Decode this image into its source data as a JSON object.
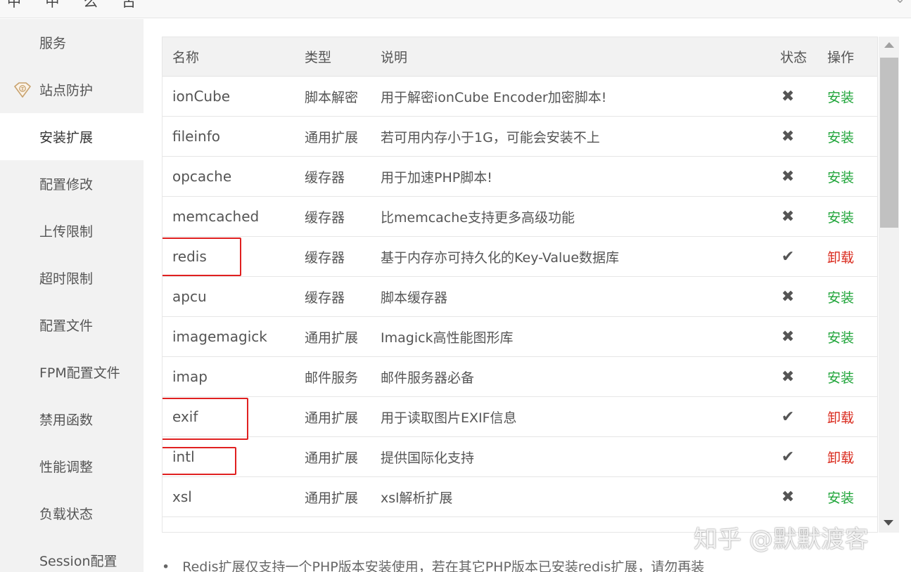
{
  "topbar": {
    "title": "中 中 么 古",
    "chevron": "⌄"
  },
  "sidebar": {
    "items": [
      {
        "label": "服务",
        "active": false
      },
      {
        "label": "站点防护",
        "active": false,
        "icon": "shield-icon"
      },
      {
        "label": "安装扩展",
        "active": true
      },
      {
        "label": "配置修改",
        "active": false
      },
      {
        "label": "上传限制",
        "active": false
      },
      {
        "label": "超时限制",
        "active": false
      },
      {
        "label": "配置文件",
        "active": false
      },
      {
        "label": "FPM配置文件",
        "active": false
      },
      {
        "label": "禁用函数",
        "active": false
      },
      {
        "label": "性能调整",
        "active": false
      },
      {
        "label": "负载状态",
        "active": false
      },
      {
        "label": "Session配置",
        "active": false
      }
    ]
  },
  "table": {
    "headers": {
      "name": "名称",
      "type": "类型",
      "desc": "说明",
      "status": "状态",
      "action": "操作"
    },
    "rows": [
      {
        "name": "ionCube",
        "type": "脚本解密",
        "desc": "用于解密ionCube Encoder加密脚本!",
        "status": "✖",
        "action": "安装"
      },
      {
        "name": "fileinfo",
        "type": "通用扩展",
        "desc": "若可用内存小于1G，可能会安装不上",
        "status": "✖",
        "action": "安装"
      },
      {
        "name": "opcache",
        "type": "缓存器",
        "desc": "用于加速PHP脚本!",
        "status": "✖",
        "action": "安装"
      },
      {
        "name": "memcached",
        "type": "缓存器",
        "desc": "比memcache支持更多高级功能",
        "status": "✖",
        "action": "安装"
      },
      {
        "name": "redis",
        "type": "缓存器",
        "desc": "基于内存亦可持久化的Key-Value数据库",
        "status": "✔",
        "action": "卸载"
      },
      {
        "name": "apcu",
        "type": "缓存器",
        "desc": "脚本缓存器",
        "status": "✖",
        "action": "安装"
      },
      {
        "name": "imagemagick",
        "type": "通用扩展",
        "desc": "Imagick高性能图形库",
        "status": "✖",
        "action": "安装"
      },
      {
        "name": "imap",
        "type": "邮件服务",
        "desc": "邮件服务器必备",
        "status": "✖",
        "action": "安装"
      },
      {
        "name": "exif",
        "type": "通用扩展",
        "desc": "用于读取图片EXIF信息",
        "status": "✔",
        "action": "卸载"
      },
      {
        "name": "intl",
        "type": "通用扩展",
        "desc": "提供国际化支持",
        "status": "✔",
        "action": "卸载"
      },
      {
        "name": "xsl",
        "type": "通用扩展",
        "desc": "xsl解析扩展",
        "status": "✖",
        "action": "安装"
      }
    ]
  },
  "note": {
    "bullet": "•",
    "text": "Redis扩展仅支持一个PHP版本安装使用，若在其它PHP版本已安装redis扩展，请勿再装"
  },
  "watermark": "知乎 @默默渡客",
  "colors": {
    "install": "#20a53a",
    "uninstall": "#d9291c",
    "highlight": "#e02020",
    "sidebar_bg": "#f2f2f2"
  }
}
